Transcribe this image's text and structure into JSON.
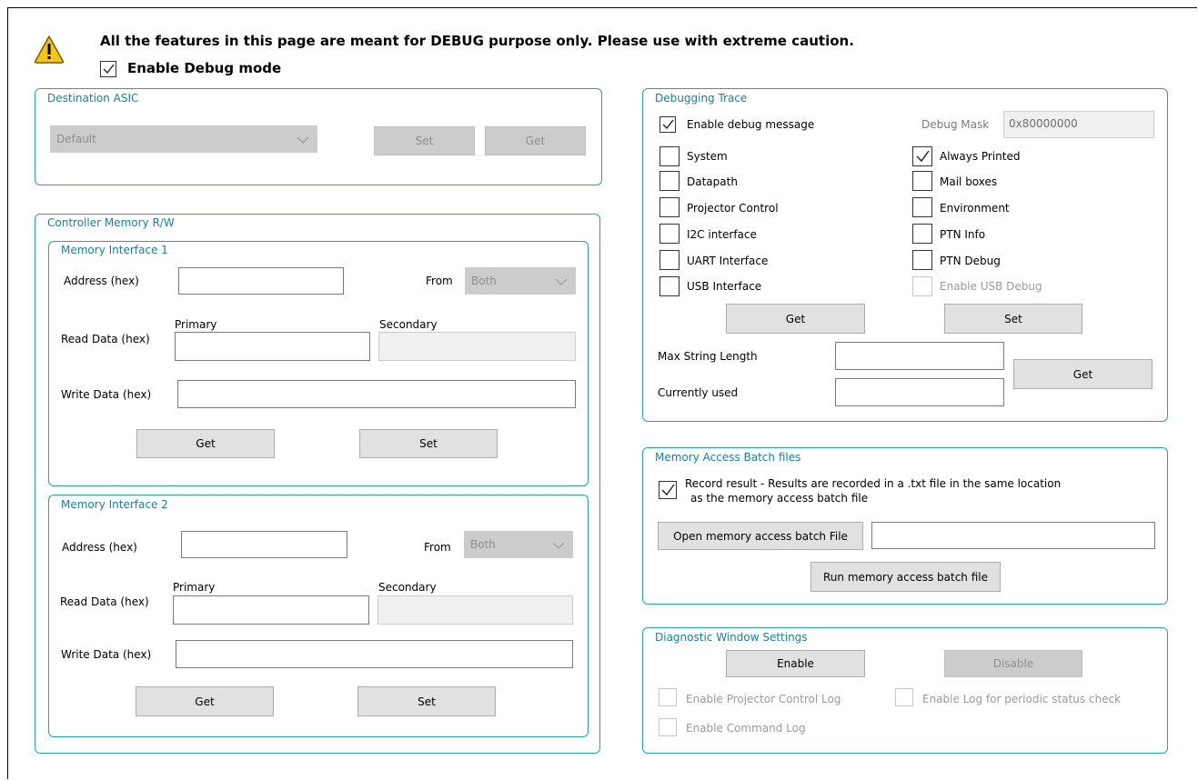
{
  "warning": {
    "text": "All the features in this page are meant for DEBUG purpose only.  Please use with extreme caution.",
    "enable_debug_label": "Enable Debug mode",
    "enable_debug_checked": true
  },
  "destination_asic": {
    "title": "Destination ASIC",
    "select_value": "Default",
    "set_label": "Set",
    "get_label": "Get"
  },
  "controller_memory": {
    "title": "Controller Memory R/W",
    "interface1": {
      "title": "Memory Interface 1",
      "address_label": "Address (hex)",
      "address_value": "",
      "from_label": "From",
      "from_value": "Both",
      "primary_label": "Primary",
      "secondary_label": "Secondary",
      "read_label": "Read Data (hex)",
      "write_label": "Write Data (hex)",
      "get_label": "Get",
      "set_label": "Set"
    },
    "interface2": {
      "title": "Memory Interface 2",
      "address_label": "Address (hex)",
      "address_value": "",
      "from_label": "From",
      "from_value": "Both",
      "primary_label": "Primary",
      "secondary_label": "Secondary",
      "read_label": "Read Data (hex)",
      "write_label": "Write Data (hex)",
      "get_label": "Get",
      "set_label": "Set"
    }
  },
  "debug_trace": {
    "title": "Debugging Trace",
    "enable_msg_label": "Enable debug message",
    "enable_msg_checked": true,
    "mask_label": "Debug Mask",
    "mask_value": "0x80000000",
    "left_options": [
      {
        "label": "System",
        "checked": false
      },
      {
        "label": "Datapath",
        "checked": false
      },
      {
        "label": "Projector Control",
        "checked": false
      },
      {
        "label": "I2C interface",
        "checked": false
      },
      {
        "label": "UART Interface",
        "checked": false
      },
      {
        "label": "USB Interface",
        "checked": false
      }
    ],
    "right_options": [
      {
        "label": "Always Printed",
        "checked": true
      },
      {
        "label": "Mail boxes",
        "checked": false
      },
      {
        "label": "Environment",
        "checked": false
      },
      {
        "label": "PTN Info",
        "checked": false
      },
      {
        "label": "PTN Debug",
        "checked": false
      },
      {
        "label": "Enable USB Debug",
        "checked": false
      }
    ],
    "get_label": "Get",
    "set_label": "Set",
    "max_len_label": "Max String Length",
    "used_label": "Currently used",
    "get2_label": "Get"
  },
  "batch": {
    "title": "Memory Access Batch files",
    "record_label_line1": "Record result - Results are recorded in a .txt file in the same location",
    "record_label_line2": "as the memory access batch file",
    "record_checked": true,
    "open_label": "Open memory access batch File",
    "file_path": "",
    "run_label": "Run memory access batch file"
  },
  "diagnostic": {
    "title": "Diagnostic Window Settings",
    "enable_label": "Enable",
    "disable_label": "Disable",
    "proj_log_label": "Enable Projector Control Log",
    "periodic_label": "Enable Log for periodic status check",
    "cmd_log_label": "Enable Command Log"
  }
}
